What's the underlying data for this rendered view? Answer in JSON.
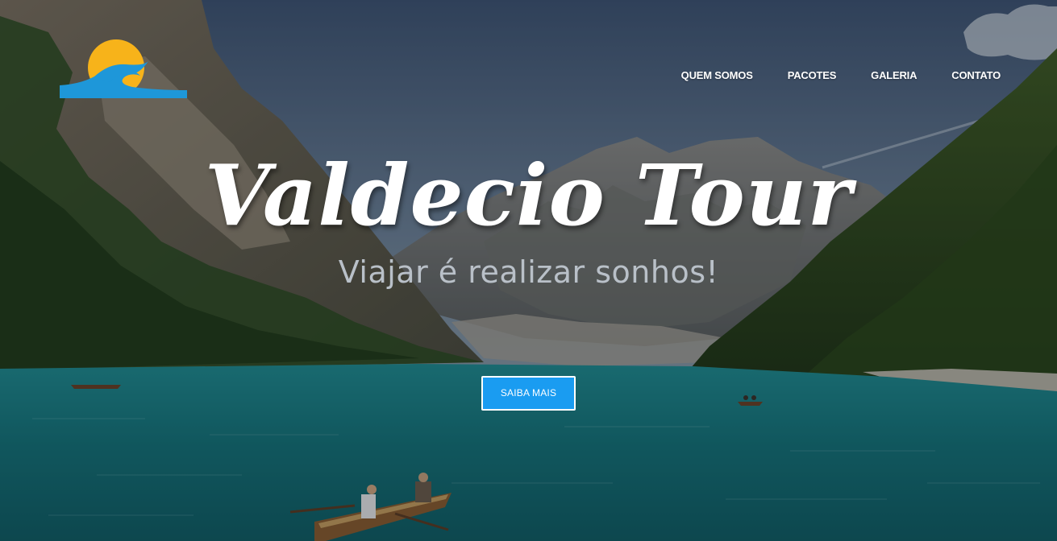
{
  "brand": {
    "logo_icon": "sun-wave-logo-icon"
  },
  "nav": {
    "items": [
      {
        "label": "QUEM SOMOS"
      },
      {
        "label": "PACOTES"
      },
      {
        "label": "GALERIA"
      },
      {
        "label": "CONTATO"
      }
    ]
  },
  "hero": {
    "title": "Valdecio Tour",
    "subtitle": "Viajar é realizar sonhos!",
    "cta_label": "SAIBA MAIS",
    "background_icon": "mountain-lake-photo"
  },
  "colors": {
    "accent": "#1a9cf1",
    "logo_sun": "#f7b31a",
    "logo_wave": "#1e97d9",
    "lake": "#177f80"
  }
}
